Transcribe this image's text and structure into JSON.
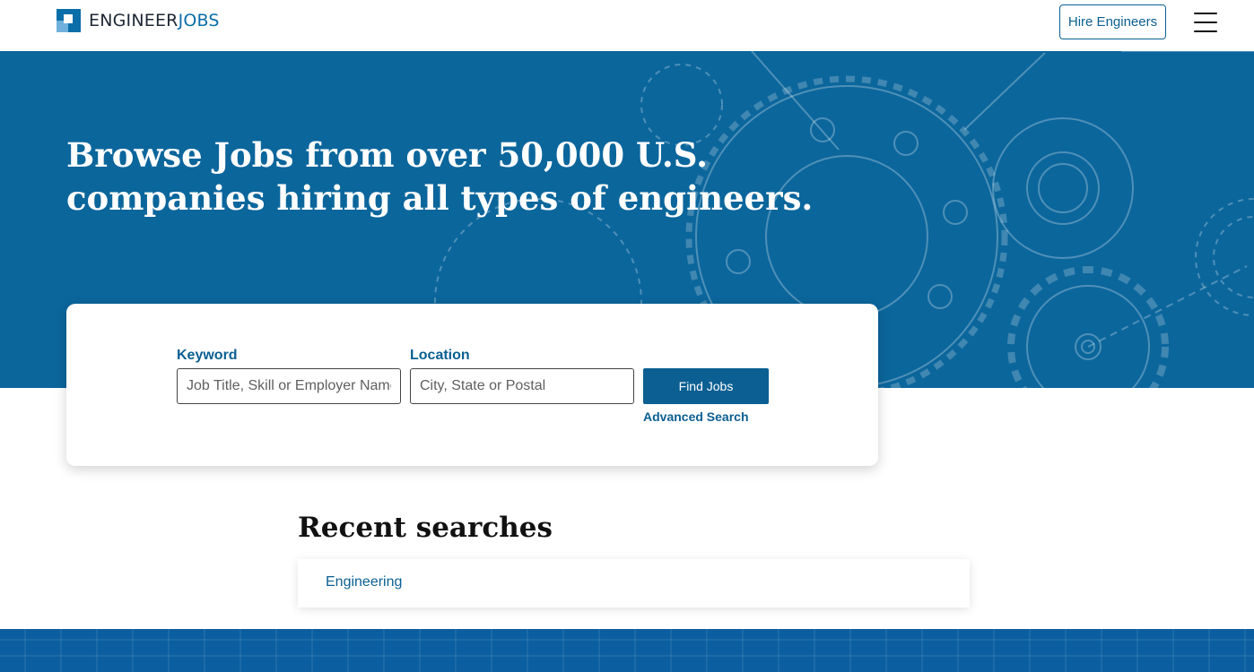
{
  "header": {
    "logo_prefix": "ENGINEER",
    "logo_suffix": "JOBS",
    "hire_button": "Hire Engineers"
  },
  "hero": {
    "title_line1": "Browse Jobs from over 50,000 U.S.",
    "title_line2": "companies hiring all types of engineers."
  },
  "search": {
    "keyword_label": "Keyword",
    "keyword_placeholder": "Job Title, Skill or Employer Name",
    "keyword_value": "",
    "location_label": "Location",
    "location_placeholder": "City, State or Postal",
    "location_value": "",
    "find_button": "Find Jobs",
    "advanced_link": "Advanced Search"
  },
  "recent": {
    "title": "Recent searches",
    "items": [
      "Engineering"
    ]
  },
  "colors": {
    "brand_blue": "#0b669c",
    "link_blue": "#0b5f92",
    "footer_blue": "#0b5fa0"
  },
  "icons": {
    "menu": "hamburger-menu-icon",
    "logo": "engineerjobs-logo-icon"
  }
}
